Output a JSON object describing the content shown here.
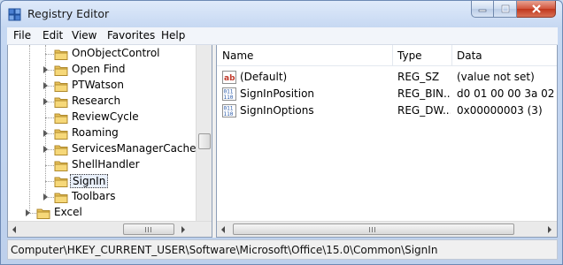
{
  "window": {
    "title": "Registry Editor"
  },
  "menu": [
    "File",
    "Edit",
    "View",
    "Favorites",
    "Help"
  ],
  "tree": {
    "items": [
      {
        "label": "OnObjectControl",
        "expandable": false
      },
      {
        "label": "Open Find",
        "expandable": true
      },
      {
        "label": "PTWatson",
        "expandable": true
      },
      {
        "label": "Research",
        "expandable": true
      },
      {
        "label": "ReviewCycle",
        "expandable": false
      },
      {
        "label": "Roaming",
        "expandable": true
      },
      {
        "label": "ServicesManagerCache",
        "expandable": true
      },
      {
        "label": "ShellHandler",
        "expandable": false
      },
      {
        "label": "SignIn",
        "expandable": false,
        "selected": true
      },
      {
        "label": "Toolbars",
        "expandable": true
      },
      {
        "label": "Excel",
        "expandable": true
      }
    ]
  },
  "list": {
    "columns": [
      "Name",
      "Type",
      "Data"
    ],
    "rows": [
      {
        "name": "(Default)",
        "type": "REG_SZ",
        "data": "(value not set)",
        "icon": "string-value-icon"
      },
      {
        "name": "SignInPosition",
        "type": "REG_BIN...",
        "data": "d0 01 00 00 3a 02 00 0",
        "icon": "binary-value-icon"
      },
      {
        "name": "SignInOptions",
        "type": "REG_DW...",
        "data": "0x00000003 (3)",
        "icon": "binary-value-icon"
      }
    ]
  },
  "status": {
    "path": "Computer\\HKEY_CURRENT_USER\\Software\\Microsoft\\Office\\15.0\\Common\\SignIn"
  },
  "colors": {
    "accent": "#c6d8f2",
    "selection": "#e9f0fb",
    "close": "#c0371d"
  }
}
